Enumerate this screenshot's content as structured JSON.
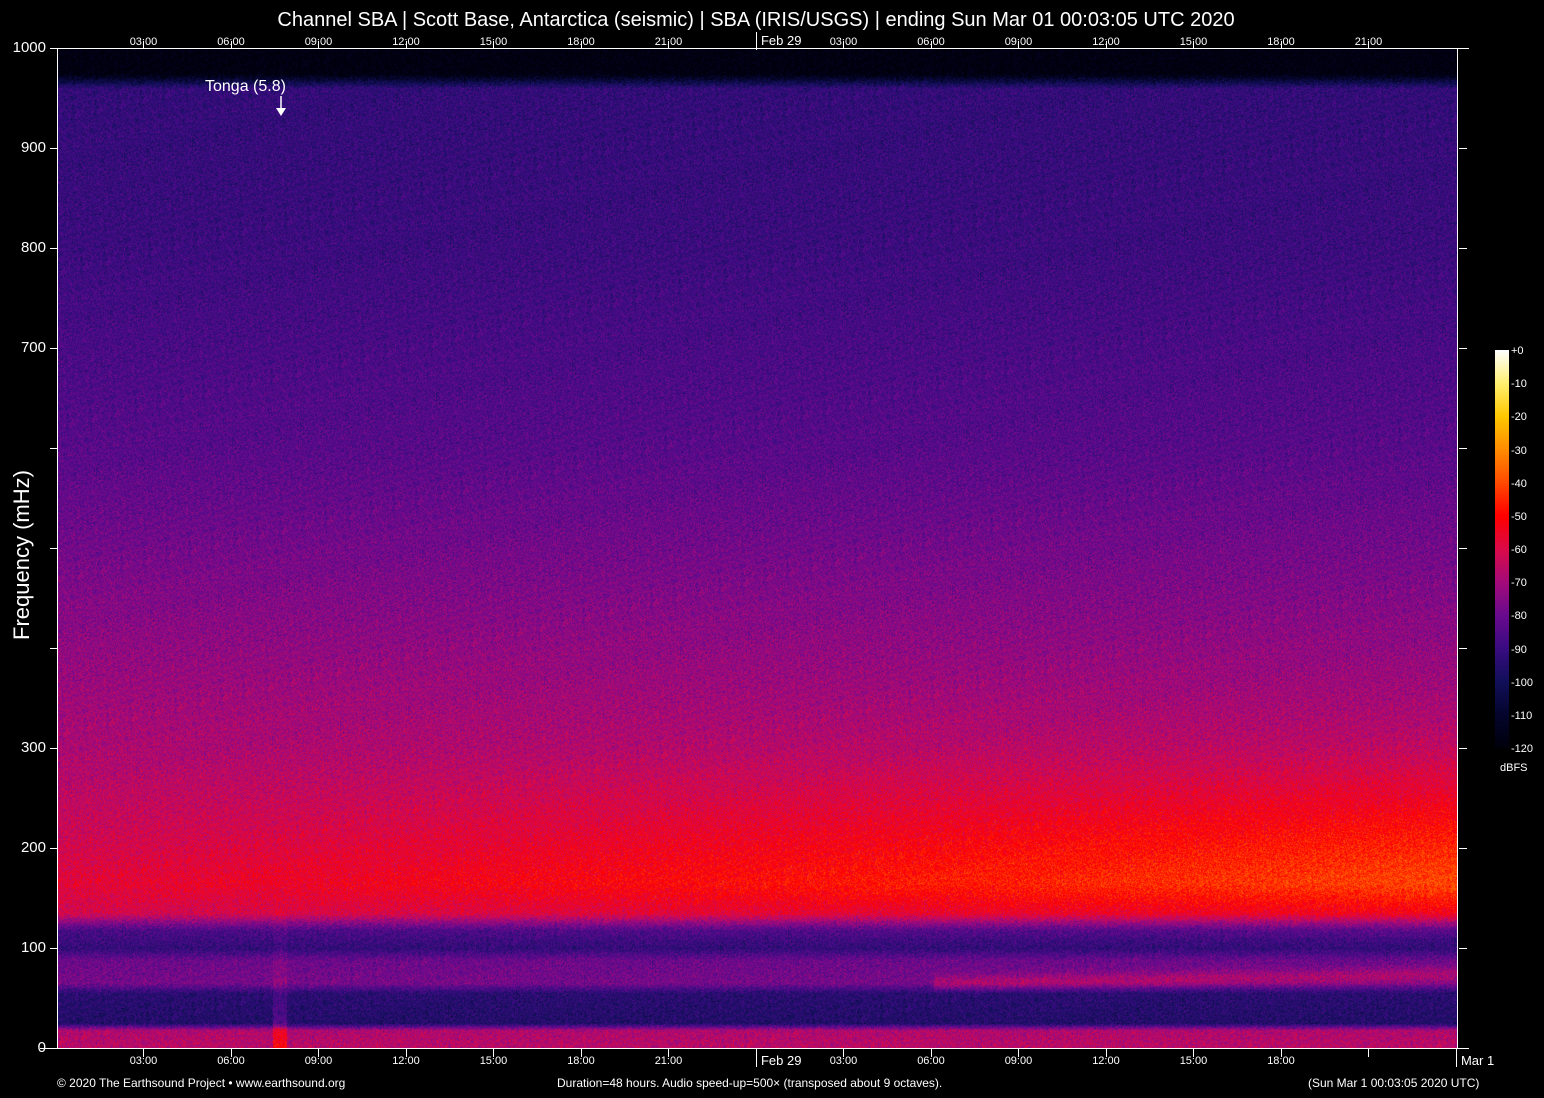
{
  "chart_data": {
    "type": "heatmap",
    "title": "Channel SBA | Scott Base, Antarctica (seismic) | SBA (IRIS/USGS) | ending Sun Mar 01 00:03:05 UTC 2020",
    "ylabel": "Frequency (mHz)",
    "ylim": [
      0,
      1000
    ],
    "y_ticks": [
      0,
      100,
      200,
      300,
      400,
      500,
      600,
      700,
      800,
      900,
      1000
    ],
    "y_tick_labels": [
      "0",
      "100",
      "200",
      "300",
      "",
      "",
      "",
      "700",
      "800",
      "900",
      "1000"
    ],
    "x_range_hours": [
      0,
      48
    ],
    "x_start_offset_hours": -23.93,
    "x_ticks_bottom": [
      {
        "h": 3,
        "label": "03:00"
      },
      {
        "h": 6,
        "label": "06:00"
      },
      {
        "h": 9,
        "label": "09:00"
      },
      {
        "h": 12,
        "label": "12:00"
      },
      {
        "h": 15,
        "label": "15:00"
      },
      {
        "h": 18,
        "label": "18:00"
      },
      {
        "h": 21,
        "label": "21:00"
      },
      {
        "h": 27,
        "label": "03:00"
      },
      {
        "h": 30,
        "label": "06:00"
      },
      {
        "h": 33,
        "label": "09:00"
      },
      {
        "h": 36,
        "label": "12:00"
      },
      {
        "h": 39,
        "label": "15:00"
      },
      {
        "h": 42,
        "label": "18:00"
      },
      {
        "h": 45,
        "label": ""
      }
    ],
    "x_ticks_top": [
      {
        "h": 3,
        "label": "03:00"
      },
      {
        "h": 6,
        "label": "06:00"
      },
      {
        "h": 9,
        "label": "09:00"
      },
      {
        "h": 12,
        "label": "12:00"
      },
      {
        "h": 15,
        "label": "15:00"
      },
      {
        "h": 18,
        "label": "18:00"
      },
      {
        "h": 21,
        "label": "21:00"
      },
      {
        "h": 27,
        "label": "03:00"
      },
      {
        "h": 30,
        "label": "06:00"
      },
      {
        "h": 33,
        "label": "09:00"
      },
      {
        "h": 36,
        "label": "12:00"
      },
      {
        "h": 39,
        "label": "15:00"
      },
      {
        "h": 42,
        "label": "18:00"
      },
      {
        "h": 45,
        "label": "21:00"
      }
    ],
    "day_labels_bottom": [
      {
        "h": 24,
        "label": "Feb 29"
      },
      {
        "h": 48,
        "label": "Mar  1"
      }
    ],
    "day_labels_top": [
      {
        "h": 24,
        "label": "Feb 29"
      }
    ],
    "colorbar": {
      "label": "dBFS",
      "range": [
        -120,
        0
      ],
      "ticks": [
        "+0",
        "-10",
        "-20",
        "-30",
        "-40",
        "-50",
        "-60",
        "-70",
        "-80",
        "-90",
        "-100",
        "-110",
        "-120"
      ],
      "colors": [
        {
          "db": -120,
          "hex": "#00000c"
        },
        {
          "db": -110,
          "hex": "#05052e"
        },
        {
          "db": -100,
          "hex": "#12105a"
        },
        {
          "db": -90,
          "hex": "#3a0c82"
        },
        {
          "db": -80,
          "hex": "#6a0a8e"
        },
        {
          "db": -70,
          "hex": "#a40a7a"
        },
        {
          "db": -60,
          "hex": "#dc0a48"
        },
        {
          "db": -50,
          "hex": "#ff0000"
        },
        {
          "db": -40,
          "hex": "#ff4a00"
        },
        {
          "db": -30,
          "hex": "#ff8c00"
        },
        {
          "db": -20,
          "hex": "#ffc800"
        },
        {
          "db": -10,
          "hex": "#fff070"
        },
        {
          "db": 0,
          "hex": "#ffffff"
        }
      ]
    },
    "intensity_profile_db": [
      {
        "f": 0,
        "db": -66
      },
      {
        "f": 18,
        "db": -68
      },
      {
        "f": 25,
        "db": -96
      },
      {
        "f": 55,
        "db": -94
      },
      {
        "f": 65,
        "db": -78
      },
      {
        "f": 88,
        "db": -80
      },
      {
        "f": 100,
        "db": -92
      },
      {
        "f": 118,
        "db": -86
      },
      {
        "f": 135,
        "db": -60
      },
      {
        "f": 165,
        "db": -54
      },
      {
        "f": 220,
        "db": -60
      },
      {
        "f": 300,
        "db": -68
      },
      {
        "f": 450,
        "db": -76
      },
      {
        "f": 600,
        "db": -84
      },
      {
        "f": 800,
        "db": -90
      },
      {
        "f": 960,
        "db": -92
      },
      {
        "f": 975,
        "db": -120
      },
      {
        "f": 1000,
        "db": -120
      }
    ],
    "events": [
      {
        "label": "Tonga (5.8)",
        "h": 7.6
      }
    ]
  },
  "footer": {
    "left": "© 2020 The Earthsound Project • www.earthsound.org",
    "center": "Duration=48 hours. Audio speed-up=500× (transposed about 9 octaves).",
    "right": "(Sun Mar  1 00:03:05 2020 UTC)"
  }
}
